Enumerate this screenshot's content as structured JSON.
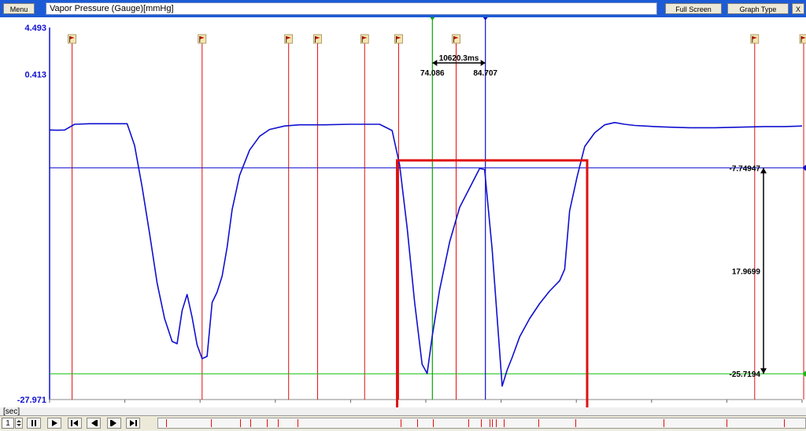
{
  "toolbar": {
    "menu_label": "Menu",
    "title": "Vapor Pressure (Gauge)[mmHg]",
    "full_screen_label": "Full Screen",
    "graph_type_label": "Graph Type",
    "close_label": "X"
  },
  "status": {
    "x_unit": "[sec]",
    "page_value": "1"
  },
  "chart_data": {
    "type": "line",
    "ylabel": "Vapor Pressure (Gauge)[mmHg]",
    "xlabel": "[sec]",
    "xlim": [
      0,
      150.476
    ],
    "ylim": [
      -27.971,
      4.493
    ],
    "x_ticks": [
      "0",
      "15.048",
      "30.095",
      "45.143",
      "60.19",
      "75.238",
      "90.286",
      "105.333",
      "120.381",
      "135.428",
      "150.476"
    ],
    "x_tick_values": [
      0,
      15.048,
      30.095,
      45.143,
      60.19,
      75.238,
      90.286,
      105.333,
      120.381,
      135.428,
      150.476
    ],
    "y_ticks": [
      "4.493",
      "0.413",
      "-27.971"
    ],
    "y_tick_values": [
      4.493,
      0.413,
      -27.971
    ],
    "series": [
      {
        "color": "#1010d0",
        "x": [
          0,
          1.5,
          3,
          5,
          8,
          12,
          15.5,
          17,
          18.5,
          20,
          21.5,
          23,
          24.5,
          25.5,
          26.5,
          27.5,
          28.5,
          29.5,
          30.5,
          31.5,
          32.5,
          33.5,
          34.5,
          35.5,
          36.5,
          38,
          40,
          42,
          44,
          47,
          50,
          55,
          60,
          66,
          68.5,
          70,
          71.5,
          73,
          74.5,
          75.5,
          76.5,
          78,
          80,
          82,
          84,
          86,
          87,
          88.5,
          90.5,
          91.5,
          92.5,
          94,
          96,
          98,
          100,
          102,
          103,
          104,
          105.5,
          107,
          109,
          111,
          113,
          115,
          117,
          119,
          121,
          124,
          128,
          133,
          138,
          143,
          147,
          150.476
        ],
        "y": [
          -4.45,
          -4.47,
          -4.45,
          -3.95,
          -3.9,
          -3.9,
          -3.9,
          -5.8,
          -9.4,
          -13.5,
          -17.8,
          -20.9,
          -22.9,
          -23.1,
          -20.2,
          -18.8,
          -20.8,
          -23.2,
          -24.4,
          -24.2,
          -19.5,
          -18.6,
          -17.2,
          -14.7,
          -11.4,
          -8.4,
          -6.2,
          -5,
          -4.4,
          -4.1,
          -4,
          -4,
          -3.95,
          -3.95,
          -4.5,
          -7.5,
          -13,
          -19.5,
          -24.9,
          -25.7,
          -22.5,
          -18.4,
          -14.2,
          -11.2,
          -9.5,
          -7.8,
          -7.9,
          -14.9,
          -26.8,
          -25.4,
          -24.3,
          -22.5,
          -20.9,
          -19.6,
          -18.5,
          -17.6,
          -16.6,
          -11.5,
          -8.5,
          -5.9,
          -4.7,
          -4.0,
          -3.8,
          -3.95,
          -4.05,
          -4.1,
          -4.15,
          -4.2,
          -4.25,
          -4.25,
          -4.2,
          -4.15,
          -4.15,
          -4.1
        ]
      }
    ],
    "event_markers_x": [
      4.5,
      30.5,
      47.8,
      53.6,
      63,
      69.8,
      81.3,
      141,
      150.8,
      160,
      180.5,
      188,
      193,
      194.5,
      196.5,
      201,
      221.5,
      243,
      294,
      331,
      364.5
    ],
    "cursors": [
      {
        "color": "#00aa00",
        "x": 76.55,
        "value": "74.086"
      },
      {
        "color": "#1010d0",
        "x": 87.15,
        "value": "84.707"
      }
    ],
    "cursor_delta_label": "10620.3ms",
    "level_lines": [
      {
        "color": "#1010d0",
        "y": -7.74947,
        "label": "-7.74947"
      },
      {
        "color": "#10c010",
        "y": -25.7194,
        "label": "-25.7194"
      }
    ],
    "level_delta_label": "17.9699",
    "highlight_box": {
      "color": "#e01010",
      "x_range": [
        69.5,
        107.5
      ],
      "y_range": [
        -28.9,
        -7.1
      ]
    }
  }
}
